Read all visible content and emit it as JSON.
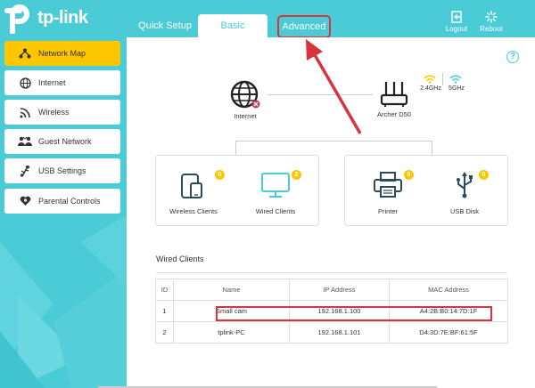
{
  "brand": {
    "logo_text": "tp-link"
  },
  "tabs": {
    "quick_setup": "Quick Setup",
    "basic": "Basic",
    "advanced": "Advanced"
  },
  "header_buttons": {
    "logout": "Logout",
    "reboot": "Reboot"
  },
  "sidebar": {
    "items": [
      {
        "label": "Network Map",
        "icon": "network-map-icon",
        "active": true
      },
      {
        "label": "Internet",
        "icon": "globe-icon"
      },
      {
        "label": "Wireless",
        "icon": "wireless-icon"
      },
      {
        "label": "Guest Network",
        "icon": "guest-network-icon"
      },
      {
        "label": "USB Settings",
        "icon": "usb-icon"
      },
      {
        "label": "Parental Controls",
        "icon": "heart-icon"
      }
    ]
  },
  "network_map": {
    "internet_label": "Internet",
    "router_label": "Archer D50",
    "band_24": "2.4GHz",
    "band_5": "5GHz",
    "wireless_clients": {
      "label": "Wireless Clients",
      "count": "0"
    },
    "wired_clients": {
      "label": "Wired Clients",
      "count": "2"
    },
    "printer": {
      "label": "Printer",
      "count": "0"
    },
    "usb_disk": {
      "label": "USB Disk",
      "count": "0"
    }
  },
  "wired_clients_table": {
    "title": "Wired Clients",
    "columns": [
      "ID",
      "Name",
      "IP Address",
      "MAC Address"
    ],
    "rows": [
      [
        "1",
        "Small cam",
        "192.168.1.100",
        "A4:2B:B0:14:7D:1F"
      ],
      [
        "2",
        "tplink-PC",
        "192.168.1.101",
        "D4:3D:7E:BF:61:5F"
      ]
    ]
  },
  "colors": {
    "teal": "#4acbd6",
    "accent_yellow": "#fdc700",
    "highlight_red": "#d6343e"
  }
}
